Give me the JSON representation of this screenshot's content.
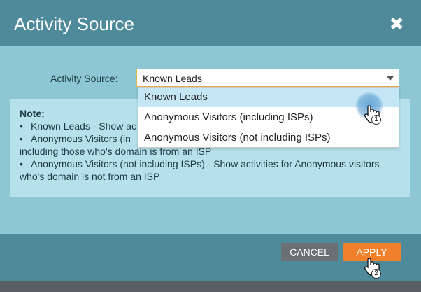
{
  "dialog": {
    "title": "Activity Source",
    "close_symbol": "✖",
    "field_label": "Activity Source:",
    "select_value": "Known Leads",
    "options": [
      "Known Leads",
      "Anonymous Visitors (including ISPs)",
      "Anonymous Visitors (not including ISPs)"
    ],
    "highlighted_option": "Known Leads"
  },
  "note": {
    "title": "Note:",
    "bullet": "•",
    "lines": [
      "Known Leads - Show ac",
      "Anonymous Visitors (in",
      "including those who's domain is from an ISP",
      "Anonymous Visitors (not including ISPs) - Show activities for Anonymous visitors",
      "who's domain is not from an ISP"
    ]
  },
  "buttons": {
    "cancel": "CANCEL",
    "apply": "APPLY"
  },
  "cursors": {
    "step1": "1",
    "step2": "2"
  },
  "colors": {
    "titlebar": "#4e8a9a",
    "body": "#8cc7d3",
    "note_bg": "#b7e1ea",
    "apply": "#f0812a",
    "cancel": "#6b7074",
    "highlight": "#c5e6f5"
  }
}
